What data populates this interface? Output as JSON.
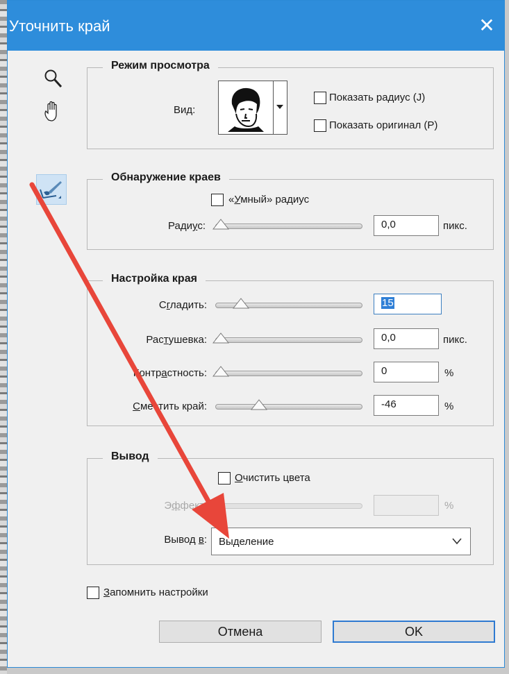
{
  "dialog": {
    "title": "Уточнить край",
    "close": "✕"
  },
  "tools": [
    "zoom-icon",
    "hand-icon",
    "refine-radius-brush-icon"
  ],
  "view_mode": {
    "legend": "Режим просмотра",
    "view_label": "Вид:",
    "show_radius": {
      "label": "Показать радиус (J)",
      "checked": false
    },
    "show_original": {
      "label": "Показать оригинал (P)",
      "checked": false
    }
  },
  "edge_detection": {
    "legend": "Обнаружение краев",
    "smart_radius": {
      "pre": "«",
      "u": "У",
      "post": "мный» радиус",
      "checked": false
    },
    "radius": {
      "label_pre": "Ради",
      "label_u": "у",
      "label_post": "с:",
      "value": "0,0",
      "unit": "пикс."
    }
  },
  "adjust_edge": {
    "legend": "Настройка края",
    "smooth": {
      "pre": "С",
      "u": "г",
      "post": "ладить:",
      "value": "15"
    },
    "feather": {
      "pre": "Рас",
      "u": "т",
      "post": "ушевка:",
      "value": "0,0",
      "unit": "пикс."
    },
    "contrast": {
      "pre": "Контр",
      "u": "а",
      "post": "стность:",
      "value": "0",
      "unit": "%"
    },
    "shift_edge": {
      "pre": "",
      "u": "С",
      "post": "местить край:",
      "value": "-46",
      "unit": "%"
    }
  },
  "output": {
    "legend": "Вывод",
    "decontaminate": {
      "u": "О",
      "post": "чистить цвета",
      "checked": false
    },
    "amount": {
      "pre": "Э",
      "u": "ф",
      "post": "фект:",
      "value": "",
      "unit": "%"
    },
    "output_to": {
      "pre": "Вывод ",
      "u": "в",
      "post": ":",
      "value": "Выделение"
    }
  },
  "remember": {
    "u": "З",
    "post": "апомнить настройки",
    "checked": false
  },
  "buttons": {
    "cancel": "Отмена",
    "ok": "OK"
  },
  "colors": {
    "titlebar": "#2e8ddb",
    "annotation_arrow": "#e8463a"
  }
}
